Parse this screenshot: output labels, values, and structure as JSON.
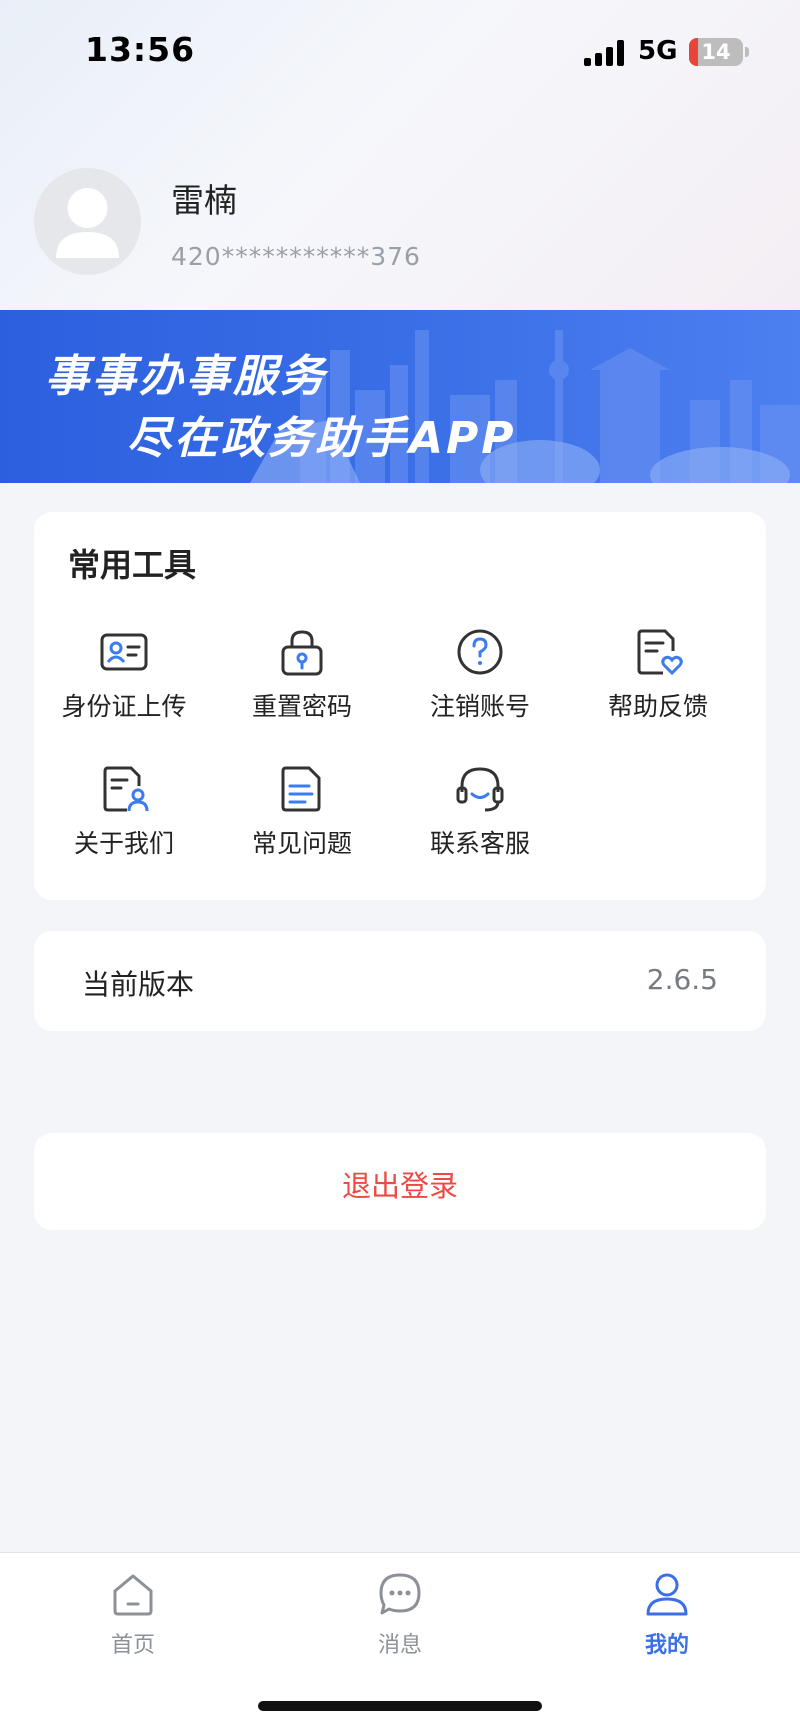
{
  "status_bar": {
    "time": "13:56",
    "network": "5G",
    "battery": "14"
  },
  "profile": {
    "name": "雷楠",
    "id_masked": "420***********376"
  },
  "banner": {
    "line1": "事事办事服务",
    "line2": "尽在政务助手APP"
  },
  "tools": {
    "title": "常用工具",
    "items": [
      {
        "label": "身份证上传",
        "icon": "id-card-icon"
      },
      {
        "label": "重置密码",
        "icon": "lock-icon"
      },
      {
        "label": "注销账号",
        "icon": "question-icon"
      },
      {
        "label": "帮助反馈",
        "icon": "feedback-heart-icon"
      },
      {
        "label": "关于我们",
        "icon": "document-user-icon"
      },
      {
        "label": "常见问题",
        "icon": "document-list-icon"
      },
      {
        "label": "联系客服",
        "icon": "headset-icon"
      }
    ]
  },
  "version": {
    "label": "当前版本",
    "value": "2.6.5"
  },
  "logout": {
    "label": "退出登录"
  },
  "tabbar": {
    "items": [
      {
        "label": "首页",
        "icon": "home-icon",
        "active": false
      },
      {
        "label": "消息",
        "icon": "message-icon",
        "active": false
      },
      {
        "label": "我的",
        "icon": "user-icon",
        "active": true
      }
    ]
  },
  "colors": {
    "accent": "#3b6fe8",
    "danger": "#ee4a44",
    "banner": "#2b5fde"
  }
}
